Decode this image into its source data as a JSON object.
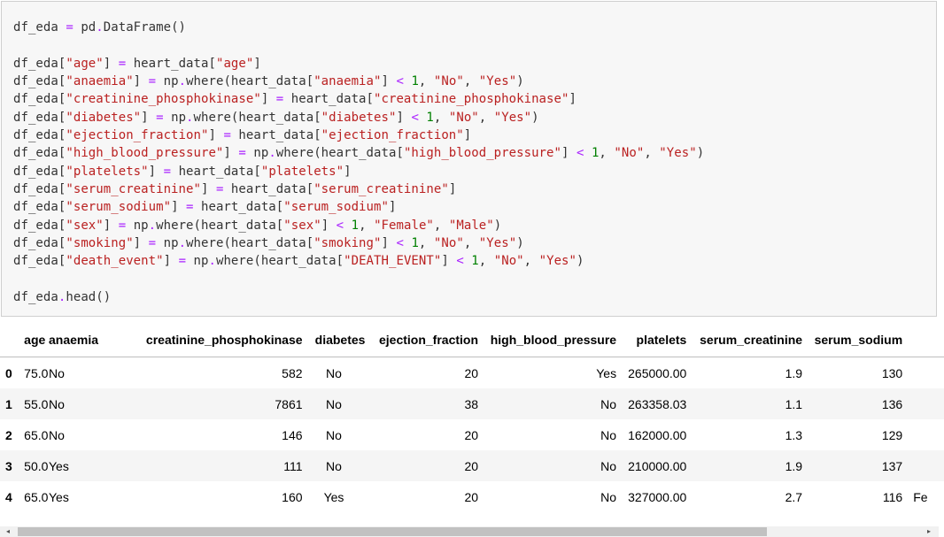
{
  "code_cell": {
    "lines": [
      [
        {
          "t": "df_eda ",
          "c": "var"
        },
        {
          "t": "=",
          "c": "op"
        },
        {
          "t": " pd",
          "c": "var"
        },
        {
          "t": ".",
          "c": "op"
        },
        {
          "t": "DataFrame()",
          "c": "var"
        }
      ],
      [],
      [
        {
          "t": "df_eda[",
          "c": "var"
        },
        {
          "t": "\"age\"",
          "c": "str"
        },
        {
          "t": "] ",
          "c": "var"
        },
        {
          "t": "=",
          "c": "op"
        },
        {
          "t": " heart_data[",
          "c": "var"
        },
        {
          "t": "\"age\"",
          "c": "str"
        },
        {
          "t": "]",
          "c": "var"
        }
      ],
      [
        {
          "t": "df_eda[",
          "c": "var"
        },
        {
          "t": "\"anaemia\"",
          "c": "str"
        },
        {
          "t": "] ",
          "c": "var"
        },
        {
          "t": "=",
          "c": "op"
        },
        {
          "t": " np",
          "c": "var"
        },
        {
          "t": ".",
          "c": "op"
        },
        {
          "t": "where(heart_data[",
          "c": "var"
        },
        {
          "t": "\"anaemia\"",
          "c": "str"
        },
        {
          "t": "] ",
          "c": "var"
        },
        {
          "t": "<",
          "c": "op"
        },
        {
          "t": " ",
          "c": "var"
        },
        {
          "t": "1",
          "c": "num"
        },
        {
          "t": ", ",
          "c": "var"
        },
        {
          "t": "\"No\"",
          "c": "str"
        },
        {
          "t": ", ",
          "c": "var"
        },
        {
          "t": "\"Yes\"",
          "c": "str"
        },
        {
          "t": ")",
          "c": "var"
        }
      ],
      [
        {
          "t": "df_eda[",
          "c": "var"
        },
        {
          "t": "\"creatinine_phosphokinase\"",
          "c": "str"
        },
        {
          "t": "] ",
          "c": "var"
        },
        {
          "t": "=",
          "c": "op"
        },
        {
          "t": " heart_data[",
          "c": "var"
        },
        {
          "t": "\"creatinine_phosphokinase\"",
          "c": "str"
        },
        {
          "t": "]",
          "c": "var"
        }
      ],
      [
        {
          "t": "df_eda[",
          "c": "var"
        },
        {
          "t": "\"diabetes\"",
          "c": "str"
        },
        {
          "t": "] ",
          "c": "var"
        },
        {
          "t": "=",
          "c": "op"
        },
        {
          "t": " np",
          "c": "var"
        },
        {
          "t": ".",
          "c": "op"
        },
        {
          "t": "where(heart_data[",
          "c": "var"
        },
        {
          "t": "\"diabetes\"",
          "c": "str"
        },
        {
          "t": "] ",
          "c": "var"
        },
        {
          "t": "<",
          "c": "op"
        },
        {
          "t": " ",
          "c": "var"
        },
        {
          "t": "1",
          "c": "num"
        },
        {
          "t": ", ",
          "c": "var"
        },
        {
          "t": "\"No\"",
          "c": "str"
        },
        {
          "t": ", ",
          "c": "var"
        },
        {
          "t": "\"Yes\"",
          "c": "str"
        },
        {
          "t": ")",
          "c": "var"
        }
      ],
      [
        {
          "t": "df_eda[",
          "c": "var"
        },
        {
          "t": "\"ejection_fraction\"",
          "c": "str"
        },
        {
          "t": "] ",
          "c": "var"
        },
        {
          "t": "=",
          "c": "op"
        },
        {
          "t": " heart_data[",
          "c": "var"
        },
        {
          "t": "\"ejection_fraction\"",
          "c": "str"
        },
        {
          "t": "]",
          "c": "var"
        }
      ],
      [
        {
          "t": "df_eda[",
          "c": "var"
        },
        {
          "t": "\"high_blood_pressure\"",
          "c": "str"
        },
        {
          "t": "] ",
          "c": "var"
        },
        {
          "t": "=",
          "c": "op"
        },
        {
          "t": " np",
          "c": "var"
        },
        {
          "t": ".",
          "c": "op"
        },
        {
          "t": "where(heart_data[",
          "c": "var"
        },
        {
          "t": "\"high_blood_pressure\"",
          "c": "str"
        },
        {
          "t": "] ",
          "c": "var"
        },
        {
          "t": "<",
          "c": "op"
        },
        {
          "t": " ",
          "c": "var"
        },
        {
          "t": "1",
          "c": "num"
        },
        {
          "t": ", ",
          "c": "var"
        },
        {
          "t": "\"No\"",
          "c": "str"
        },
        {
          "t": ", ",
          "c": "var"
        },
        {
          "t": "\"Yes\"",
          "c": "str"
        },
        {
          "t": ")",
          "c": "var"
        }
      ],
      [
        {
          "t": "df_eda[",
          "c": "var"
        },
        {
          "t": "\"platelets\"",
          "c": "str"
        },
        {
          "t": "] ",
          "c": "var"
        },
        {
          "t": "=",
          "c": "op"
        },
        {
          "t": " heart_data[",
          "c": "var"
        },
        {
          "t": "\"platelets\"",
          "c": "str"
        },
        {
          "t": "]",
          "c": "var"
        }
      ],
      [
        {
          "t": "df_eda[",
          "c": "var"
        },
        {
          "t": "\"serum_creatinine\"",
          "c": "str"
        },
        {
          "t": "] ",
          "c": "var"
        },
        {
          "t": "=",
          "c": "op"
        },
        {
          "t": " heart_data[",
          "c": "var"
        },
        {
          "t": "\"serum_creatinine\"",
          "c": "str"
        },
        {
          "t": "]",
          "c": "var"
        }
      ],
      [
        {
          "t": "df_eda[",
          "c": "var"
        },
        {
          "t": "\"serum_sodium\"",
          "c": "str"
        },
        {
          "t": "] ",
          "c": "var"
        },
        {
          "t": "=",
          "c": "op"
        },
        {
          "t": " heart_data[",
          "c": "var"
        },
        {
          "t": "\"serum_sodium\"",
          "c": "str"
        },
        {
          "t": "]",
          "c": "var"
        }
      ],
      [
        {
          "t": "df_eda[",
          "c": "var"
        },
        {
          "t": "\"sex\"",
          "c": "str"
        },
        {
          "t": "] ",
          "c": "var"
        },
        {
          "t": "=",
          "c": "op"
        },
        {
          "t": " np",
          "c": "var"
        },
        {
          "t": ".",
          "c": "op"
        },
        {
          "t": "where(heart_data[",
          "c": "var"
        },
        {
          "t": "\"sex\"",
          "c": "str"
        },
        {
          "t": "] ",
          "c": "var"
        },
        {
          "t": "<",
          "c": "op"
        },
        {
          "t": " ",
          "c": "var"
        },
        {
          "t": "1",
          "c": "num"
        },
        {
          "t": ", ",
          "c": "var"
        },
        {
          "t": "\"Female\"",
          "c": "str"
        },
        {
          "t": ", ",
          "c": "var"
        },
        {
          "t": "\"Male\"",
          "c": "str"
        },
        {
          "t": ")",
          "c": "var"
        }
      ],
      [
        {
          "t": "df_eda[",
          "c": "var"
        },
        {
          "t": "\"smoking\"",
          "c": "str"
        },
        {
          "t": "] ",
          "c": "var"
        },
        {
          "t": "=",
          "c": "op"
        },
        {
          "t": " np",
          "c": "var"
        },
        {
          "t": ".",
          "c": "op"
        },
        {
          "t": "where(heart_data[",
          "c": "var"
        },
        {
          "t": "\"smoking\"",
          "c": "str"
        },
        {
          "t": "] ",
          "c": "var"
        },
        {
          "t": "<",
          "c": "op"
        },
        {
          "t": " ",
          "c": "var"
        },
        {
          "t": "1",
          "c": "num"
        },
        {
          "t": ", ",
          "c": "var"
        },
        {
          "t": "\"No\"",
          "c": "str"
        },
        {
          "t": ", ",
          "c": "var"
        },
        {
          "t": "\"Yes\"",
          "c": "str"
        },
        {
          "t": ")",
          "c": "var"
        }
      ],
      [
        {
          "t": "df_eda[",
          "c": "var"
        },
        {
          "t": "\"death_event\"",
          "c": "str"
        },
        {
          "t": "] ",
          "c": "var"
        },
        {
          "t": "=",
          "c": "op"
        },
        {
          "t": " np",
          "c": "var"
        },
        {
          "t": ".",
          "c": "op"
        },
        {
          "t": "where(heart_data[",
          "c": "var"
        },
        {
          "t": "\"DEATH_EVENT\"",
          "c": "str"
        },
        {
          "t": "] ",
          "c": "var"
        },
        {
          "t": "<",
          "c": "op"
        },
        {
          "t": " ",
          "c": "var"
        },
        {
          "t": "1",
          "c": "num"
        },
        {
          "t": ", ",
          "c": "var"
        },
        {
          "t": "\"No\"",
          "c": "str"
        },
        {
          "t": ", ",
          "c": "var"
        },
        {
          "t": "\"Yes\"",
          "c": "str"
        },
        {
          "t": ")",
          "c": "var"
        }
      ],
      [],
      [
        {
          "t": "df_eda",
          "c": "var"
        },
        {
          "t": ".",
          "c": "op"
        },
        {
          "t": "head()",
          "c": "var"
        }
      ]
    ],
    "token_colors": {
      "var": "#333333",
      "str": "#ba2121",
      "op": "#aa22ff",
      "num": "#008000"
    }
  },
  "output_table": {
    "columns": [
      "age",
      "anaemia",
      "creatinine_phosphokinase",
      "diabetes",
      "ejection_fraction",
      "high_blood_pressure",
      "platelets",
      "serum_creatinine",
      "serum_sodium"
    ],
    "rows": [
      {
        "index": "0",
        "cells": [
          "75.0",
          "No",
          "582",
          "No",
          "20",
          "Yes",
          "265000.00",
          "1.9",
          "130"
        ],
        "overflow": ""
      },
      {
        "index": "1",
        "cells": [
          "55.0",
          "No",
          "7861",
          "No",
          "38",
          "No",
          "263358.03",
          "1.1",
          "136"
        ],
        "overflow": ""
      },
      {
        "index": "2",
        "cells": [
          "65.0",
          "No",
          "146",
          "No",
          "20",
          "No",
          "162000.00",
          "1.3",
          "129"
        ],
        "overflow": ""
      },
      {
        "index": "3",
        "cells": [
          "50.0",
          "Yes",
          "111",
          "No",
          "20",
          "No",
          "210000.00",
          "1.9",
          "137"
        ],
        "overflow": ""
      },
      {
        "index": "4",
        "cells": [
          "65.0",
          "Yes",
          "160",
          "Yes",
          "20",
          "No",
          "327000.00",
          "2.7",
          "116"
        ],
        "overflow": "Fe"
      }
    ]
  },
  "scrollbar": {
    "left_arrow_icon": "◂",
    "right_arrow_icon": "▸",
    "position_fraction": 0.0,
    "visible_fraction": 0.81
  }
}
